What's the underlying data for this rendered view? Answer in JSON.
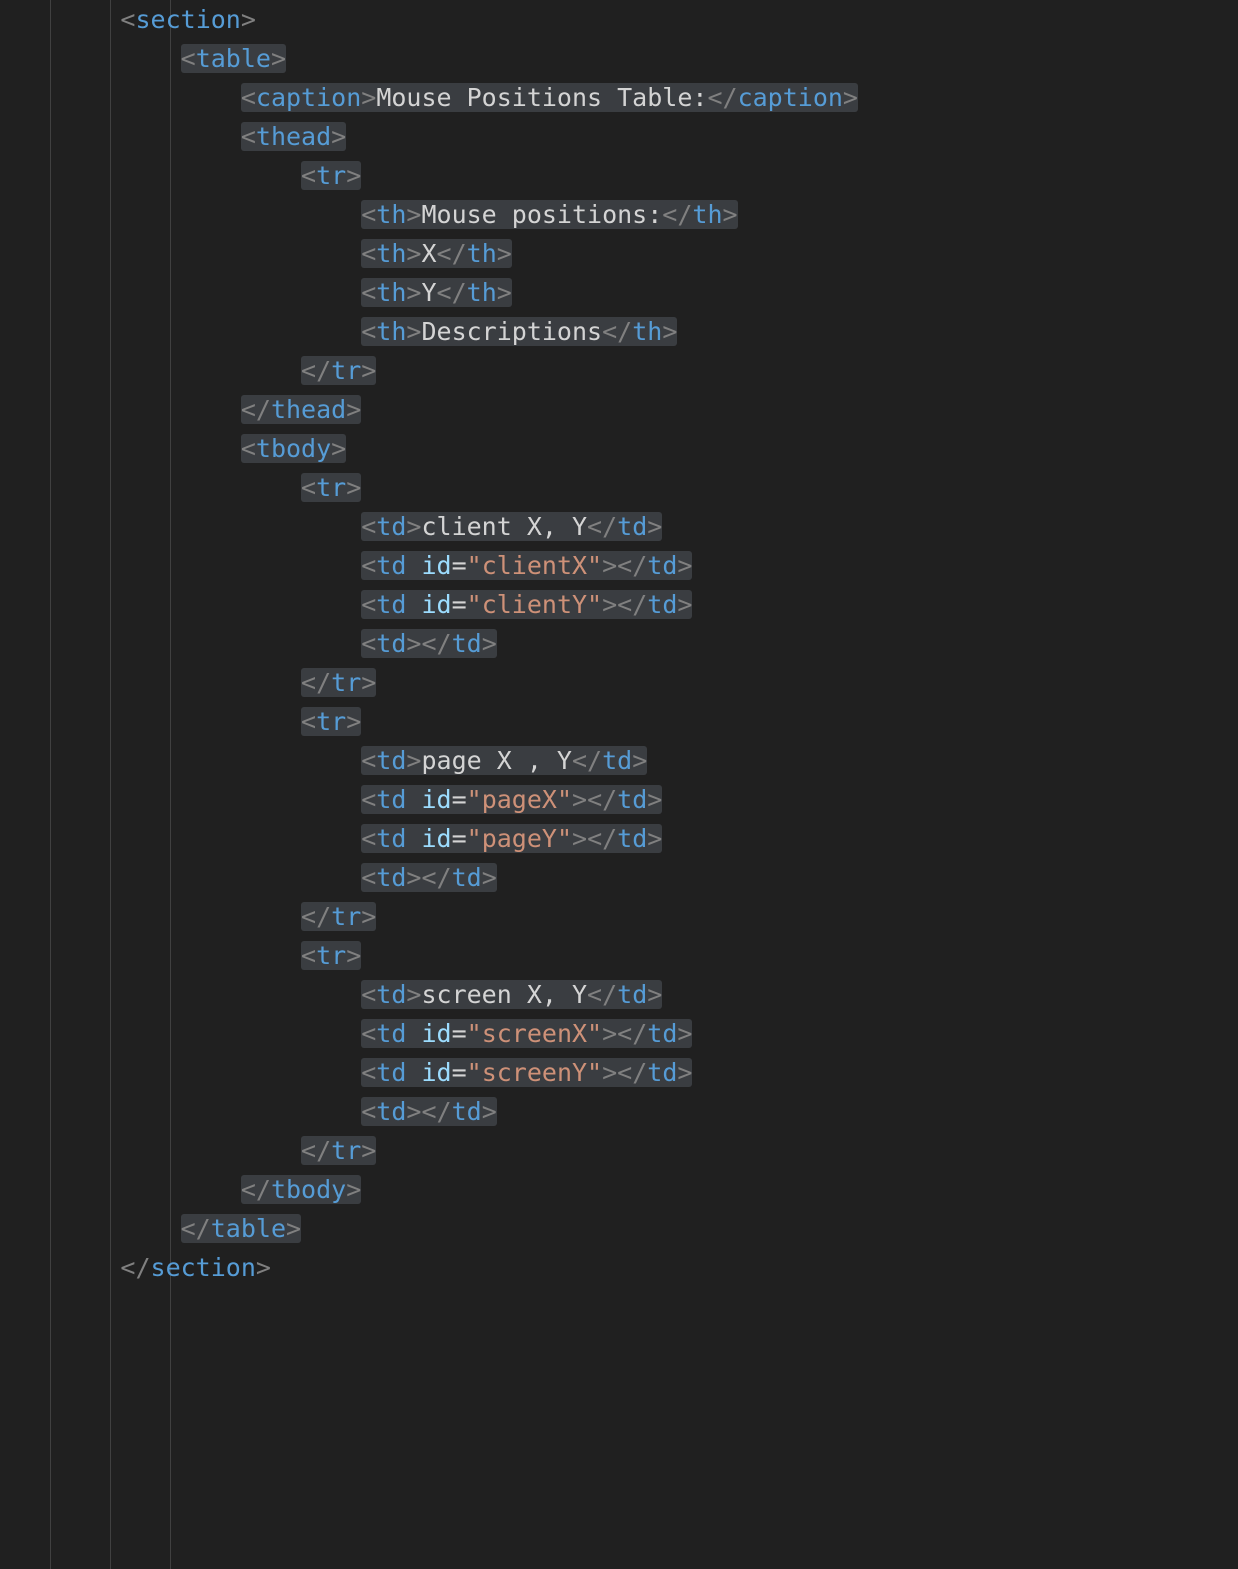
{
  "code": {
    "lines": [
      {
        "indent": 2,
        "open": "section",
        "close": null,
        "text": null,
        "attrs": [],
        "selfclose": null
      },
      {
        "indent": 3,
        "open": "table",
        "close": null,
        "text": null,
        "attrs": [],
        "selfclose": null,
        "hl": true
      },
      {
        "indent": 4,
        "open": "caption",
        "close": "caption",
        "text": "Mouse Positions Table:",
        "attrs": [],
        "hl": true
      },
      {
        "indent": 4,
        "open": "thead",
        "close": null,
        "text": null,
        "attrs": [],
        "hl": true
      },
      {
        "indent": 5,
        "open": "tr",
        "close": null,
        "text": null,
        "attrs": [],
        "hl": true
      },
      {
        "indent": 6,
        "open": "th",
        "close": "th",
        "text": "Mouse positions:",
        "attrs": [],
        "hl": true
      },
      {
        "indent": 6,
        "open": "th",
        "close": "th",
        "text": "X",
        "attrs": [],
        "hl": true
      },
      {
        "indent": 6,
        "open": "th",
        "close": "th",
        "text": "Y",
        "attrs": [],
        "hl": true
      },
      {
        "indent": 6,
        "open": "th",
        "close": "th",
        "text": "Descriptions",
        "attrs": [],
        "hl": true
      },
      {
        "indent": 5,
        "open": null,
        "close": "tr",
        "text": null,
        "attrs": [],
        "hl": true
      },
      {
        "indent": 4,
        "open": null,
        "close": "thead",
        "text": null,
        "attrs": [],
        "hl": true
      },
      {
        "indent": 4,
        "open": "tbody",
        "close": null,
        "text": null,
        "attrs": [],
        "hl": true
      },
      {
        "indent": 5,
        "open": "tr",
        "close": null,
        "text": null,
        "attrs": [],
        "hl": true
      },
      {
        "indent": 6,
        "open": "td",
        "close": "td",
        "text": "client X, Y",
        "attrs": [],
        "hl": true
      },
      {
        "indent": 6,
        "open": "td",
        "close": "td",
        "text": "",
        "attrs": [
          [
            "id",
            "clientX"
          ]
        ],
        "hl": true
      },
      {
        "indent": 6,
        "open": "td",
        "close": "td",
        "text": "",
        "attrs": [
          [
            "id",
            "clientY"
          ]
        ],
        "hl": true
      },
      {
        "indent": 6,
        "open": "td",
        "close": "td",
        "text": "",
        "attrs": [],
        "hl": true
      },
      {
        "indent": 5,
        "open": null,
        "close": "tr",
        "text": null,
        "attrs": [],
        "hl": true
      },
      {
        "indent": 5,
        "open": "tr",
        "close": null,
        "text": null,
        "attrs": [],
        "hl": true
      },
      {
        "indent": 6,
        "open": "td",
        "close": "td",
        "text": "page X , Y",
        "attrs": [],
        "hl": true
      },
      {
        "indent": 6,
        "open": "td",
        "close": "td",
        "text": "",
        "attrs": [
          [
            "id",
            "pageX"
          ]
        ],
        "hl": true
      },
      {
        "indent": 6,
        "open": "td",
        "close": "td",
        "text": "",
        "attrs": [
          [
            "id",
            "pageY"
          ]
        ],
        "hl": true
      },
      {
        "indent": 6,
        "open": "td",
        "close": "td",
        "text": "",
        "attrs": [],
        "hl": true
      },
      {
        "indent": 5,
        "open": null,
        "close": "tr",
        "text": null,
        "attrs": [],
        "hl": true
      },
      {
        "indent": 5,
        "open": "tr",
        "close": null,
        "text": null,
        "attrs": [],
        "hl": true
      },
      {
        "indent": 6,
        "open": "td",
        "close": "td",
        "text": "screen X, Y",
        "attrs": [],
        "hl": true
      },
      {
        "indent": 6,
        "open": "td",
        "close": "td",
        "text": "",
        "attrs": [
          [
            "id",
            "screenX"
          ]
        ],
        "hl": true
      },
      {
        "indent": 6,
        "open": "td",
        "close": "td",
        "text": "",
        "attrs": [
          [
            "id",
            "screenY"
          ]
        ],
        "hl": true
      },
      {
        "indent": 6,
        "open": "td",
        "close": "td",
        "text": "",
        "attrs": [],
        "hl": true
      },
      {
        "indent": 5,
        "open": null,
        "close": "tr",
        "text": null,
        "attrs": [],
        "hl": true
      },
      {
        "indent": 4,
        "open": null,
        "close": "tbody",
        "text": null,
        "attrs": [],
        "hl": true
      },
      {
        "indent": 3,
        "open": null,
        "close": "table",
        "text": null,
        "attrs": [],
        "hl": true
      },
      {
        "indent": 2,
        "open": null,
        "close": "section",
        "text": null,
        "attrs": []
      }
    ],
    "indentUnit": "    "
  }
}
